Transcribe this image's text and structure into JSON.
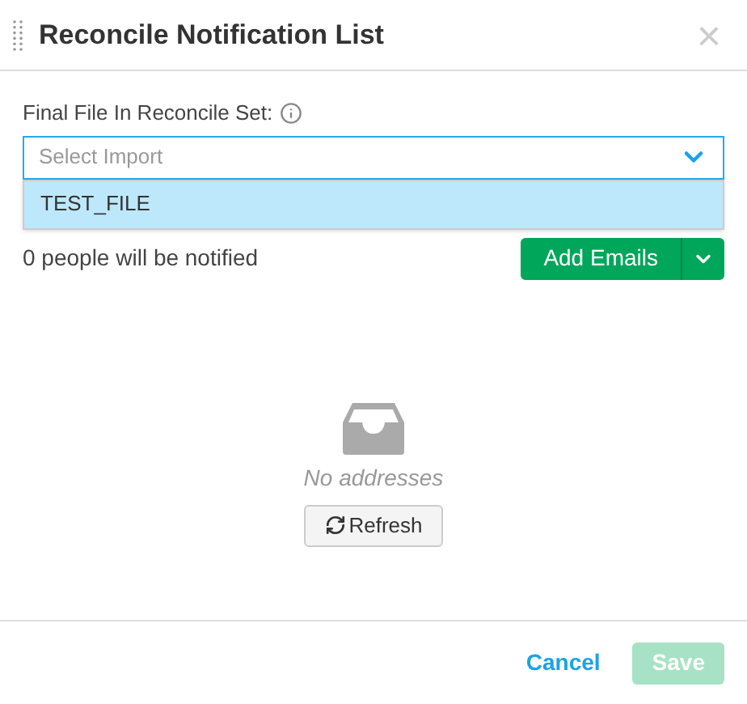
{
  "dialog": {
    "title": "Reconcile Notification List",
    "close": "×"
  },
  "field": {
    "label": "Final File In Reconcile Set:",
    "placeholder": "Select Import",
    "expanded": true,
    "options": [
      {
        "label": "TEST_FILE",
        "highlighted": true
      }
    ]
  },
  "recipients": {
    "summary": "0 people will be notified",
    "add_button": "Add Emails"
  },
  "empty_state": {
    "message": "No addresses",
    "refresh_button": "Refresh"
  },
  "footer": {
    "cancel": "Cancel",
    "save": {
      "label": "Save",
      "disabled": true
    }
  }
}
